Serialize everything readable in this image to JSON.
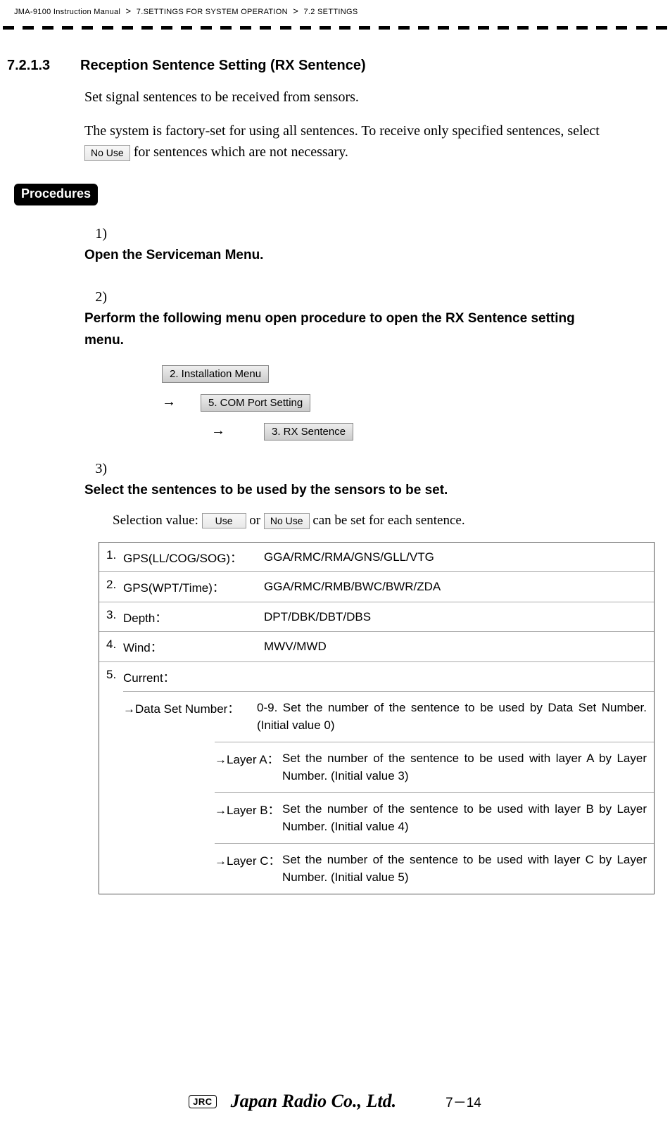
{
  "header": {
    "manual": "JMA-9100 Instruction Manual",
    "chapter": "7.SETTINGS FOR SYSTEM OPERATION",
    "section": "7.2  SETTINGS"
  },
  "section_number": "7.2.1.3",
  "section_title": "Reception Sentence Setting (RX Sentence)",
  "intro": "Set signal sentences to be received from sensors.",
  "para2_a": "The system is factory-set for using all sentences. To receive only specified sentences, select ",
  "para2_b": " for sentences which are not necessary.",
  "no_use_label": "No Use",
  "use_label": "Use",
  "procedures_label": "Procedures",
  "steps": {
    "s1": {
      "num": "1)",
      "text": "Open the Serviceman Menu."
    },
    "s2": {
      "num": "2)",
      "text": "Perform the following menu open procedure to open the RX Sentence setting menu."
    },
    "s3": {
      "num": "3)",
      "text": "Select the sentences to be used by the sensors to be set."
    }
  },
  "menu_chain": {
    "m1": "2. Installation Menu",
    "m2": "5. COM Port Setting",
    "m3": "3. RX Sentence"
  },
  "selection_a": "Selection value: ",
  "selection_b": " or ",
  "selection_c": " can be set for each sentence.",
  "table": {
    "r1": {
      "n": "1.",
      "label": "GPS(LL/COG/SOG)：",
      "val": "GGA/RMC/RMA/GNS/GLL/VTG"
    },
    "r2": {
      "n": "2.",
      "label": "GPS(WPT/Time)：",
      "val": "GGA/RMC/RMB/BWC/BWR/ZDA"
    },
    "r3": {
      "n": "3.",
      "label": "Depth：",
      "val": "DPT/DBK/DBT/DBS"
    },
    "r4": {
      "n": "4.",
      "label": "Wind：",
      "val": "MWV/MWD"
    },
    "r5": {
      "n": "5.",
      "label": "Current："
    },
    "sub1": {
      "label": "→Data Set Number：",
      "val": "0-9.  Set the number of the sentence to be used by Data Set Number. (Initial value 0)"
    },
    "sub2": {
      "label": "→Layer A：",
      "val": "Set the number of the sentence to be used with layer A by Layer Number. (Initial value 3)"
    },
    "sub3": {
      "label": "→Layer B：",
      "val": "Set the number of the sentence to be used with layer B by Layer Number. (Initial value 4)"
    },
    "sub4": {
      "label": "→Layer C：",
      "val": "Set the number of the sentence to be used with layer C by Layer Number. (Initial value 5)"
    }
  },
  "footer": {
    "jrc": "JRC",
    "company": "Japan Radio Co., Ltd.",
    "page": "7－14"
  }
}
